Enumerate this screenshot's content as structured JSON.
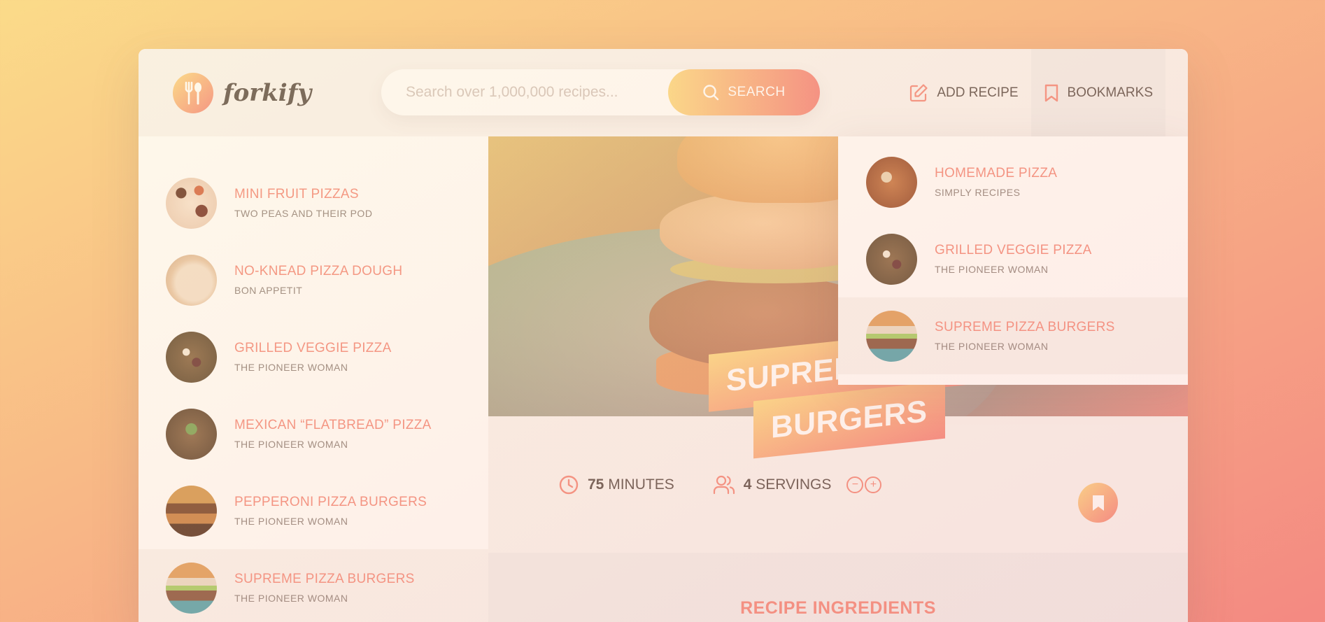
{
  "app": {
    "logo_text": "forkify"
  },
  "search": {
    "placeholder": "Search over 1,000,000 recipes...",
    "button_label": "SEARCH"
  },
  "nav": {
    "add_recipe": "ADD RECIPE",
    "bookmarks": "BOOKMARKS"
  },
  "results": [
    {
      "title": "MINI FRUIT PIZZAS",
      "publisher": "TWO PEAS AND THEIR POD"
    },
    {
      "title": "NO-KNEAD PIZZA DOUGH",
      "publisher": "BON APPETIT"
    },
    {
      "title": "GRILLED VEGGIE PIZZA",
      "publisher": "THE PIONEER WOMAN"
    },
    {
      "title": "MEXICAN “FLATBREAD” PIZZA",
      "publisher": "THE PIONEER WOMAN"
    },
    {
      "title": "PEPPERONI PIZZA BURGERS",
      "publisher": "THE PIONEER WOMAN"
    },
    {
      "title": "SUPREME PIZZA BURGERS",
      "publisher": "THE PIONEER WOMAN"
    }
  ],
  "bookmarks": [
    {
      "title": "HOMEMADE PIZZA",
      "publisher": "SIMPLY RECIPES"
    },
    {
      "title": "GRILLED VEGGIE PIZZA",
      "publisher": "THE PIONEER WOMAN"
    },
    {
      "title": "SUPREME PIZZA BURGERS",
      "publisher": "THE PIONEER WOMAN"
    }
  ],
  "recipe": {
    "title_line1": "SUPREME PIZZA",
    "title_line2": "BURGERS",
    "minutes": "75",
    "minutes_label": "MINUTES",
    "servings": "4",
    "servings_label": "SERVINGS",
    "ingredients_heading": "RECIPE INGREDIENTS"
  },
  "colors": {
    "accent": "#f38e82",
    "gradient_start": "#fbdb89",
    "gradient_end": "#f48982",
    "text": "#615551"
  }
}
